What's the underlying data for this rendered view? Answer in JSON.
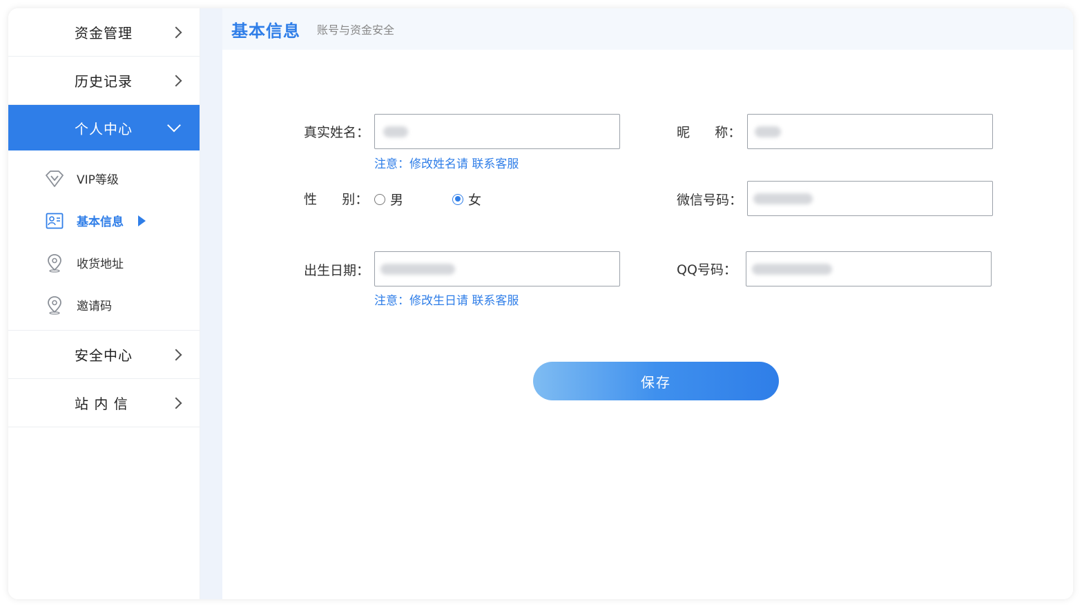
{
  "sidebar": {
    "top_items": [
      {
        "label": "资金管理"
      },
      {
        "label": "历史记录"
      },
      {
        "label": "个人中心"
      }
    ],
    "sub_items": [
      {
        "label": "VIP等级",
        "icon": "diamond-icon"
      },
      {
        "label": "基本信息",
        "icon": "id-card-icon"
      },
      {
        "label": "收货地址",
        "icon": "location-pin-icon"
      },
      {
        "label": "邀请码",
        "icon": "location-pin-icon"
      }
    ],
    "bottom_items": [
      {
        "label": "安全中心"
      },
      {
        "label": "站 内 信"
      }
    ]
  },
  "header": {
    "title": "基本信息",
    "subtitle": "账号与资金安全"
  },
  "form": {
    "real_name_label": "真实姓名：",
    "real_name_note_prefix": "注意：修改姓名请 ",
    "real_name_note_link": "联系客服",
    "nickname_label": "昵      称：",
    "gender_label": "性      别：",
    "gender_male": "男",
    "gender_female": "女",
    "gender_selected": "女",
    "wechat_label": "微信号码：",
    "birthday_label": "出生日期：",
    "birthday_note_prefix": "注意：修改生日请 ",
    "birthday_note_link": "联系客服",
    "qq_label": "QQ号码：",
    "save_label": "保存"
  },
  "colors": {
    "accent": "#2f7ee8",
    "header_bg": "#f4f8fd"
  }
}
